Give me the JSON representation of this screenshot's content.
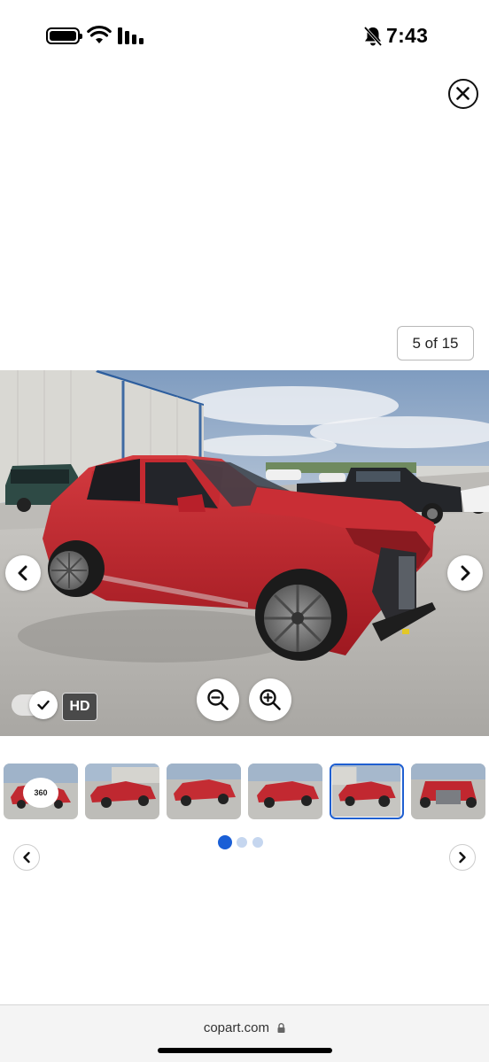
{
  "status_bar": {
    "time": "7:43",
    "icons": [
      "battery-icon",
      "wifi-icon",
      "signal-icon",
      "bell-off-icon"
    ]
  },
  "viewer": {
    "close_icon": "close-icon",
    "counter": "5 of 15",
    "hd_label": "HD",
    "zoom_out_icon": "zoom-out-icon",
    "zoom_in_icon": "zoom-in-icon",
    "prev_icon": "chevron-left-icon",
    "next_icon": "chevron-right-icon",
    "toggle_checked": true
  },
  "thumbnails": {
    "badge_360": "360",
    "active_index": 4,
    "count_visible": 6
  },
  "pagination": {
    "dots": 3,
    "active": 0
  },
  "browser": {
    "url": "copart.com"
  },
  "colors": {
    "accent": "#1f5fd1",
    "car": "#c4222c"
  }
}
